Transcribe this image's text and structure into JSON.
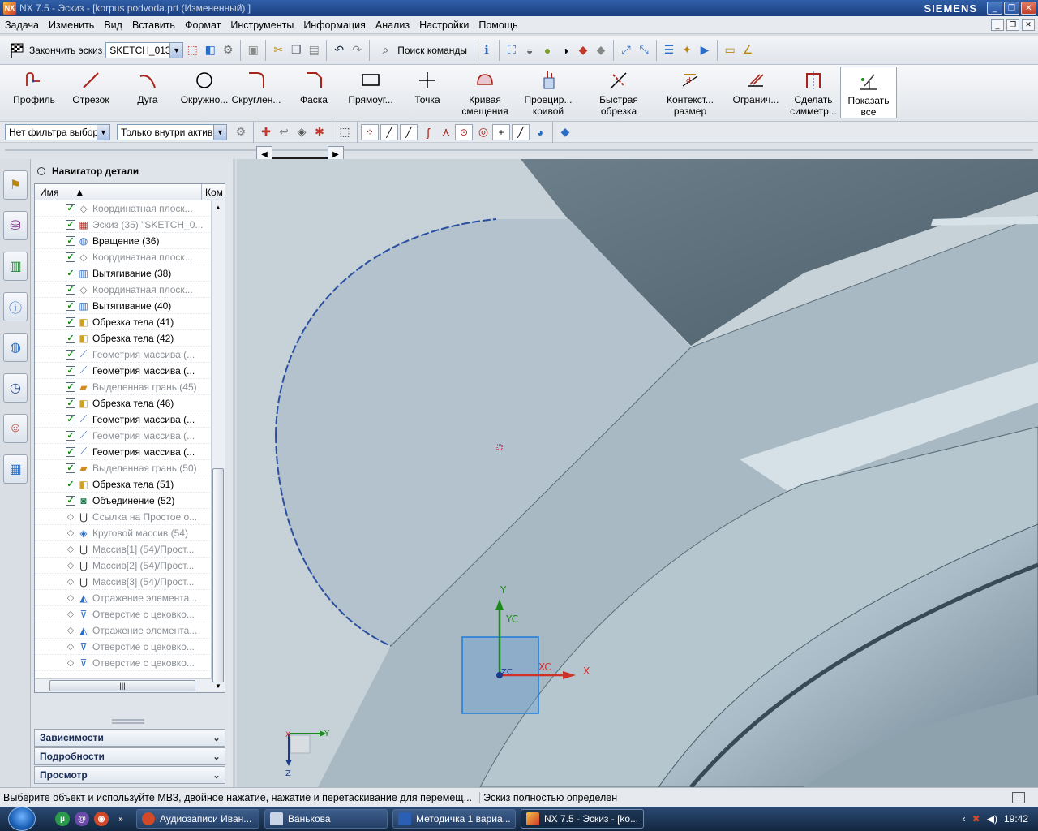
{
  "window": {
    "app_icon": "NX",
    "title": "NX 7.5 - Эскиз - [korpus podvoda.prt (Измененный) ]",
    "brand": "SIEMENS"
  },
  "menu": [
    "Задача",
    "Изменить",
    "Вид",
    "Вставить",
    "Формат",
    "Инструменты",
    "Информация",
    "Анализ",
    "Настройки",
    "Помощь"
  ],
  "toolbar1": {
    "finish_sketch": "Закончить эскиз",
    "sketch_name": "SKETCH_013",
    "command_search": "Поиск команды"
  },
  "toolbar2": [
    {
      "id": "profile",
      "label": "Профиль",
      "icon": "profile-icon"
    },
    {
      "id": "line",
      "label": "Отрезок",
      "icon": "line-icon"
    },
    {
      "id": "arc",
      "label": "Дуга",
      "icon": "arc-icon"
    },
    {
      "id": "circle",
      "label": "Окружно...",
      "icon": "circle-icon"
    },
    {
      "id": "fillet",
      "label": "Скруглен...",
      "icon": "fillet-icon"
    },
    {
      "id": "chamfer",
      "label": "Фаска",
      "icon": "chamfer-icon"
    },
    {
      "id": "rectangle",
      "label": "Прямоуг...",
      "icon": "rectangle-icon"
    },
    {
      "id": "point",
      "label": "Точка",
      "icon": "point-icon"
    },
    {
      "id": "offset",
      "label": "Кривая смещения",
      "icon": "offset-curve-icon"
    },
    {
      "id": "project",
      "label": "Проецир... кривой",
      "icon": "project-curve-icon"
    },
    {
      "id": "trim",
      "label": "Быстрая обрезка",
      "icon": "quick-trim-icon"
    },
    {
      "id": "dimension",
      "label": "Контекст... размер",
      "icon": "dimension-icon"
    },
    {
      "id": "constraint",
      "label": "Огранич...",
      "icon": "constraint-icon"
    },
    {
      "id": "symmetric",
      "label": "Сделать симметр...",
      "icon": "symmetric-icon"
    },
    {
      "id": "showall",
      "label": "Показать все",
      "icon": "show-all-icon"
    }
  ],
  "filter": {
    "type_filter": "Нет фильтра выбор",
    "scope": "Только внутри актив"
  },
  "navigator": {
    "title": "Навигатор детали",
    "col_name": "Имя",
    "col_comment": "Ком",
    "rows": [
      {
        "cb": "✓",
        "icon": "datum-plane-icon",
        "label": "Координатная плоск...",
        "style": "gray"
      },
      {
        "cb": "✓",
        "icon": "sketch-icon",
        "label": "Эскиз (35) \"SKETCH_0...",
        "style": "gray"
      },
      {
        "cb": "✓",
        "icon": "revolve-icon",
        "label": "Вращение (36)",
        "style": "bold"
      },
      {
        "cb": "✓",
        "icon": "datum-plane-icon",
        "label": "Координатная плоск...",
        "style": "gray"
      },
      {
        "cb": "✓",
        "icon": "extrude-icon",
        "label": "Вытягивание (38)",
        "style": "bold"
      },
      {
        "cb": "✓",
        "icon": "datum-plane-icon",
        "label": "Координатная плоск...",
        "style": "gray"
      },
      {
        "cb": "✓",
        "icon": "extrude-icon",
        "label": "Вытягивание (40)",
        "style": "bold"
      },
      {
        "cb": "✓",
        "icon": "trim-body-icon",
        "label": "Обрезка тела (41)",
        "style": "bold"
      },
      {
        "cb": "✓",
        "icon": "trim-body-icon",
        "label": "Обрезка тела (42)",
        "style": "bold"
      },
      {
        "cb": "✓",
        "icon": "mass-geometry-icon",
        "label": "Геометрия массива (...",
        "style": "gray"
      },
      {
        "cb": "✓",
        "icon": "mass-geometry-icon",
        "label": "Геометрия массива (...",
        "style": "bold"
      },
      {
        "cb": "✓",
        "icon": "face-icon",
        "label": "Выделенная грань (45)",
        "style": "gray"
      },
      {
        "cb": "✓",
        "icon": "trim-body-icon",
        "label": "Обрезка тела (46)",
        "style": "bold"
      },
      {
        "cb": "✓",
        "icon": "mass-geometry-icon",
        "label": "Геометрия массива (...",
        "style": "bold"
      },
      {
        "cb": "✓",
        "icon": "mass-geometry-icon",
        "label": "Геометрия массива (...",
        "style": "gray"
      },
      {
        "cb": "✓",
        "icon": "mass-geometry-icon",
        "label": "Геометрия массива (...",
        "style": "bold"
      },
      {
        "cb": "✓",
        "icon": "face-icon",
        "label": "Выделенная грань (50)",
        "style": "gray"
      },
      {
        "cb": "✓",
        "icon": "trim-body-icon",
        "label": "Обрезка тела (51)",
        "style": "bold"
      },
      {
        "cb": "✓",
        "icon": "unite-icon",
        "label": "Объединение (52)",
        "style": "bold"
      },
      {
        "cb": "◇",
        "icon": "link-icon",
        "label": "Ссылка на Простое о...",
        "style": "gray"
      },
      {
        "cb": "◇",
        "icon": "circular-array-icon",
        "label": "Круговой массив (54)",
        "style": "gray"
      },
      {
        "cb": "◇",
        "icon": "link-icon",
        "label": "Массив[1] (54)/Прост...",
        "style": "gray"
      },
      {
        "cb": "◇",
        "icon": "link-icon",
        "label": "Массив[2] (54)/Прост...",
        "style": "gray"
      },
      {
        "cb": "◇",
        "icon": "link-icon",
        "label": "Массив[3] (54)/Прост...",
        "style": "gray"
      },
      {
        "cb": "◇",
        "icon": "mirror-icon",
        "label": "Отражение элемента...",
        "style": "gray"
      },
      {
        "cb": "◇",
        "icon": "hole-icon",
        "label": "Отверстие с цековко...",
        "style": "gray"
      },
      {
        "cb": "◇",
        "icon": "mirror-icon",
        "label": "Отражение элемента...",
        "style": "gray"
      },
      {
        "cb": "◇",
        "icon": "hole-icon",
        "label": "Отверстие с цековко...",
        "style": "gray"
      },
      {
        "cb": "◇",
        "icon": "hole-icon",
        "label": "Отверстие с цековко...",
        "style": "gray"
      }
    ],
    "panels": [
      "Зависимости",
      "Подробности",
      "Просмотр"
    ]
  },
  "viewport": {
    "axes": {
      "y": "Y",
      "yc": "YC",
      "xc": "XC",
      "x": "X",
      "zc": "ZC",
      "triad_x": "X",
      "triad_y": "Y",
      "triad_z": "Z"
    }
  },
  "status": {
    "prompt": "Выберите объект и используйте МВЗ, двойное нажатие, нажатие и перетаскивание для перемещ...",
    "state": "Эскиз полностью определен"
  },
  "taskbar": {
    "tasks": [
      "Аудиозаписи Иван...",
      "Ванькова",
      "Методичка 1 вариа...",
      "NX 7.5 - Эскиз - [ko..."
    ],
    "clock": "19:42"
  }
}
